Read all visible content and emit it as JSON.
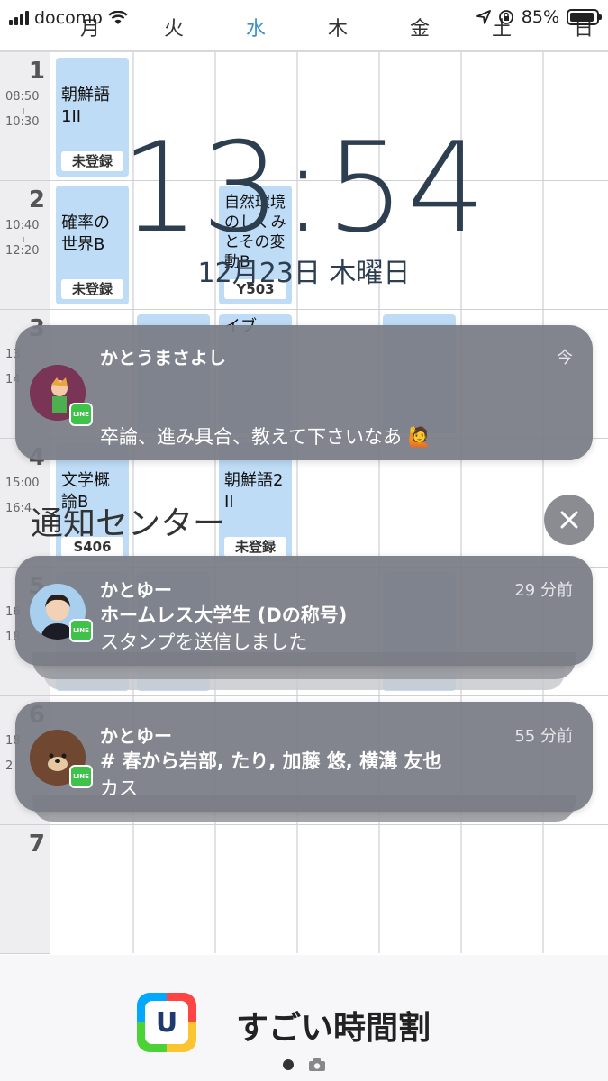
{
  "status_bar": {
    "carrier": "docomo",
    "battery": "85%"
  },
  "timetable": {
    "days": [
      "月",
      "火",
      "水",
      "木",
      "金",
      "土",
      "日"
    ],
    "today_index": 2,
    "periods": [
      {
        "num": "1",
        "start": "08:50",
        "end": "10:30"
      },
      {
        "num": "2",
        "start": "10:40",
        "end": "12:20"
      },
      {
        "num": "3",
        "start": "13",
        "end": "14"
      },
      {
        "num": "4",
        "start": "15:00",
        "end": "16:4"
      },
      {
        "num": "5",
        "start": "16",
        "end": "18"
      },
      {
        "num": "6",
        "start": "18",
        "end": "2"
      },
      {
        "num": "7",
        "start": "",
        "end": ""
      }
    ],
    "cells": [
      {
        "name": "朝鮮語\n1II",
        "room": "未登録"
      },
      {
        "name": "確率の\n世界B",
        "room": "未登録"
      },
      {
        "name": "自然環境\nのしくみ\nとその変\n動B",
        "room": "Y503"
      },
      {
        "name": "文学概\n論B",
        "room": "S406"
      },
      {
        "name": "朝鮮語2\nII",
        "room": "未登録"
      },
      {
        "name": "イブ",
        "room": ""
      }
    ]
  },
  "lock_screen": {
    "time": "13:54",
    "date": "12月23日 木曜日"
  },
  "notifications": [
    {
      "sender": "かとうまさよし",
      "time": "今",
      "subtitle": "",
      "message": "卒論、進み具合、教えて下さいなあ 🙋",
      "app": "LINE"
    },
    {
      "sender": "かとゆー",
      "time": "29 分前",
      "subtitle": "ホームレス大学生 (Dの称号)",
      "message": "スタンプを送信しました",
      "app": "LINE"
    },
    {
      "sender": "かとゆー",
      "time": "55 分前",
      "subtitle": "# 春から岩部, たり, 加藤 悠, 横溝 友也",
      "message": "カス",
      "app": "LINE"
    }
  ],
  "notification_center": {
    "label": "通知センター",
    "close_icon": "close-icon"
  },
  "widget": {
    "app_icon_letter": "U",
    "app_name": "すごい時間割"
  },
  "colors": {
    "today": "#3b8fd0",
    "class_cell": "#bfdcf6",
    "notification_bg": "#787c84",
    "line_green": "#3ec24a"
  }
}
